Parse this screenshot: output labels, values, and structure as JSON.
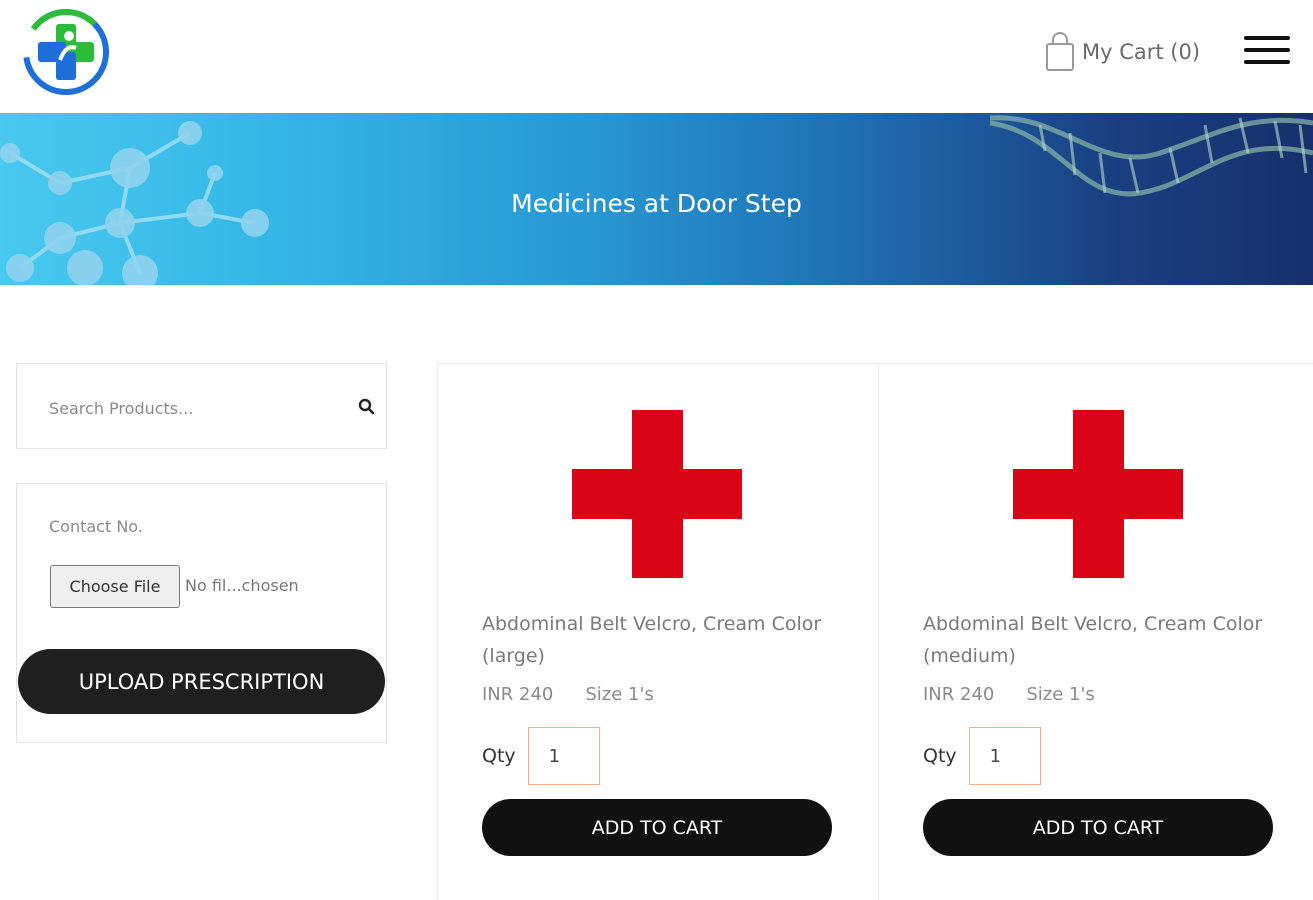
{
  "header": {
    "logo_icon": "medical-cross-logo",
    "cart_icon": "shopping-bag-icon",
    "cart_label": "My Cart (0)",
    "menu_icon": "hamburger-menu-icon"
  },
  "banner": {
    "title": "Medicines at Door Step"
  },
  "sidebar": {
    "search": {
      "placeholder": "Search Products...",
      "icon": "search-icon"
    },
    "upload": {
      "contact_placeholder": "Contact No.",
      "choose_file_label": "Choose File",
      "file_status": "No fil...chosen",
      "upload_button_label": "UPLOAD PRESCRIPTION"
    }
  },
  "products": [
    {
      "name": "Abdominal Belt Velcro, Cream Color (large)",
      "price": "INR 240",
      "size": "Size 1's",
      "qty_label": "Qty",
      "qty_value": "1",
      "button_label": "ADD TO CART",
      "image_icon": "red-cross-icon"
    },
    {
      "name": "Abdominal Belt Velcro, Cream Color (medium)",
      "price": "INR 240",
      "size": "Size 1's",
      "qty_label": "Qty",
      "qty_value": "1",
      "button_label": "ADD TO CART",
      "image_icon": "red-cross-icon"
    }
  ],
  "colors": {
    "logo_blue": "#1e6fd9",
    "logo_green": "#2dbb3a",
    "product_cross": "#d90416",
    "button_dark": "#111111",
    "banner_left": "#48c9ef",
    "banner_right": "#17306c",
    "qty_border": "#f0b08a"
  }
}
